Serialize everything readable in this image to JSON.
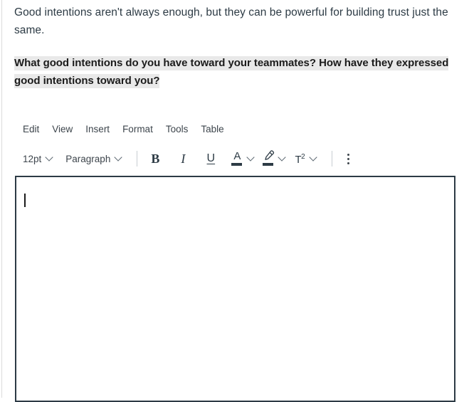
{
  "passage": {
    "paragraph": "Good intentions aren't always enough, but they can be powerful for building trust just the same.",
    "prompt": "What good intentions do you have toward your teammates? How have they expressed good intentions toward you?"
  },
  "editor": {
    "menubar": [
      {
        "label": "Edit",
        "name": "menu-item-edit"
      },
      {
        "label": "View",
        "name": "menu-item-view"
      },
      {
        "label": "Insert",
        "name": "menu-item-insert"
      },
      {
        "label": "Format",
        "name": "menu-item-format"
      },
      {
        "label": "Tools",
        "name": "menu-item-tools"
      },
      {
        "label": "Table",
        "name": "menu-item-table"
      }
    ],
    "toolbar": {
      "font_size": "12pt",
      "block_format": "Paragraph",
      "bold_label": "B",
      "italic_label": "I",
      "underline_label": "U",
      "text_color_label": "A",
      "highlight_icon": "highlighter-pen-icon",
      "superscript_label": "T",
      "superscript_exponent": "2",
      "more_icon": "kebab-menu-icon",
      "chevron_icon": "chevron-down-icon"
    },
    "body": {
      "value": "",
      "caret_visible": true
    }
  },
  "colors": {
    "text": "#2d3b45",
    "highlight_background": "#e9e9e9",
    "editor_border": "#2d3b45",
    "toolbar_divider": "#c7cdd1"
  }
}
